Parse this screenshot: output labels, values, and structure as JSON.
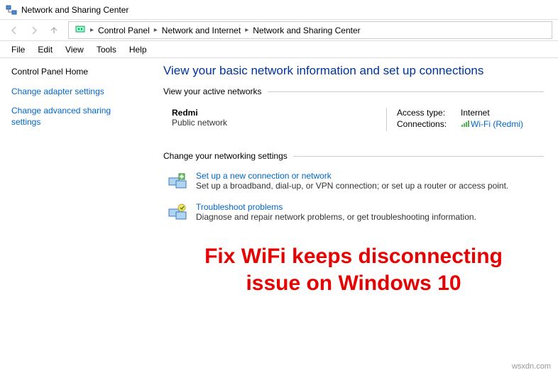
{
  "window": {
    "title": "Network and Sharing Center"
  },
  "breadcrumb": {
    "items": [
      "Control Panel",
      "Network and Internet",
      "Network and Sharing Center"
    ]
  },
  "menu": {
    "items": [
      "File",
      "Edit",
      "View",
      "Tools",
      "Help"
    ]
  },
  "sidebar": {
    "home": "Control Panel Home",
    "link1": "Change adapter settings",
    "link2": "Change advanced sharing settings"
  },
  "content": {
    "title": "View your basic network information and set up connections",
    "active_legend": "View your active networks",
    "network": {
      "name": "Redmi",
      "type": "Public network",
      "access_label": "Access type:",
      "access_value": "Internet",
      "conn_label": "Connections:",
      "conn_value": "Wi-Fi (Redmi)"
    },
    "change_legend": "Change your networking settings",
    "setup": {
      "title": "Set up a new connection or network",
      "desc": "Set up a broadband, dial-up, or VPN connection; or set up a router or access point."
    },
    "troubleshoot": {
      "title": "Troubleshoot problems",
      "desc": "Diagnose and repair network problems, or get troubleshooting information."
    }
  },
  "banner": {
    "line1": "Fix WiFi keeps disconnecting",
    "line2": "issue on Windows 10"
  },
  "watermark": "wsxdn.com"
}
